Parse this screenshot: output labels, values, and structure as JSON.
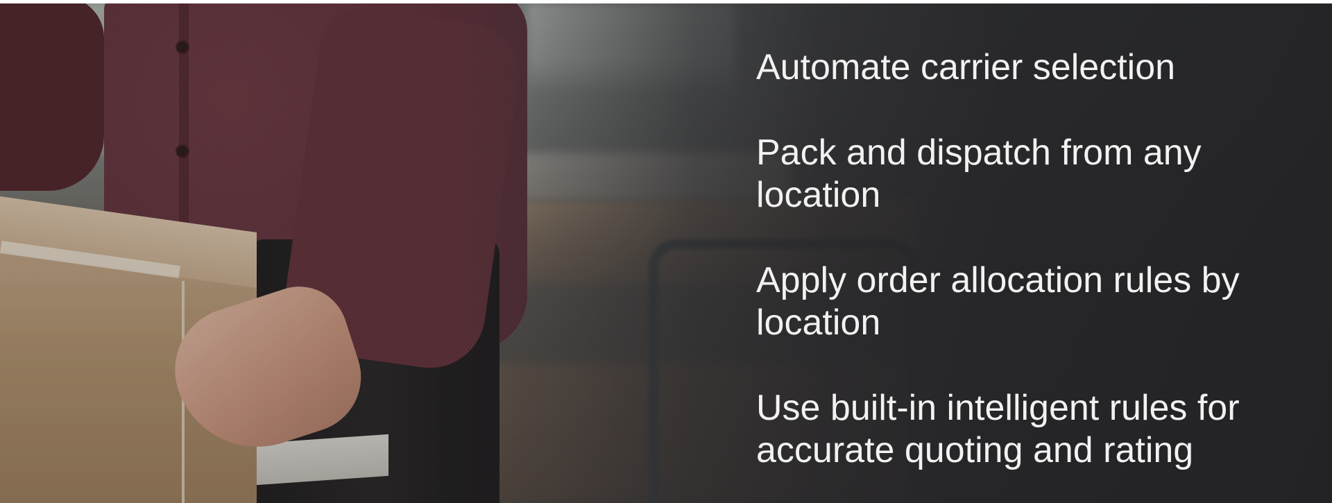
{
  "hero": {
    "image_description_icon": "photo-person-packing-box",
    "features": [
      "Automate carrier selection",
      "Pack and dispatch from any location",
      "Apply order allocation rules by location",
      "Use built-in intelligent rules for accurate quoting and rating"
    ],
    "text_color": "#f2f2f2",
    "overlay_color": "#242427"
  }
}
